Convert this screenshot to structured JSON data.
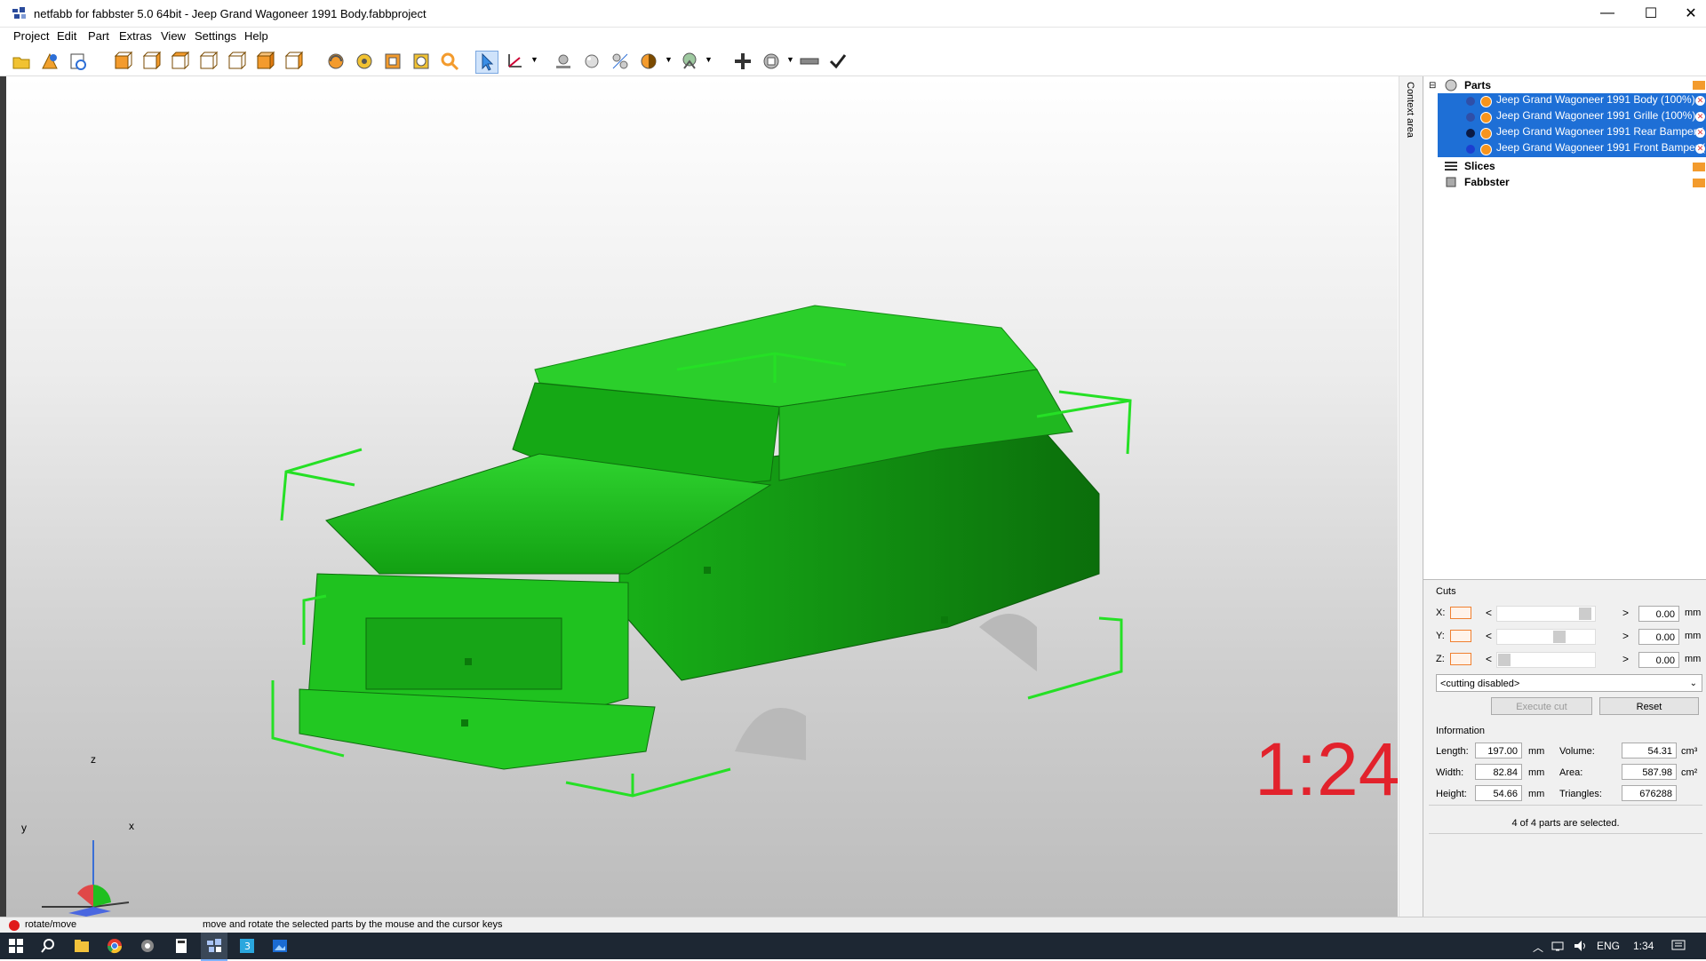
{
  "window": {
    "title": "netfabb for fabbster 5.0 64bit - Jeep Grand Wagoneer 1991 Body.fabbproject",
    "minimize": "—",
    "maximize": "☐",
    "close": "✕"
  },
  "menu": [
    "Project",
    "Edit",
    "Part",
    "Extras",
    "View",
    "Settings",
    "Help"
  ],
  "viewport": {
    "scale_text": "1:24",
    "axes": {
      "z": "z",
      "y": "y",
      "x": "x"
    },
    "model_color": "#1fc21f"
  },
  "context_tab": "Context area",
  "tree": {
    "parts_header": "Parts",
    "parts": [
      {
        "label": "Jeep Grand Wagoneer 1991 Body (100%)",
        "dot_color": "#2f4fa8"
      },
      {
        "label": "Jeep Grand Wagoneer 1991 Grille (100%)",
        "dot_color": "#2f4fa8"
      },
      {
        "label": "Jeep Grand Wagoneer 1991 Rear Bamper (",
        "dot_color": "#0b1a44"
      },
      {
        "label": "Jeep Grand Wagoneer 1991 Front Bamper (",
        "dot_color": "#1b3fd0"
      }
    ],
    "slices": "Slices",
    "fabbster": "Fabbster"
  },
  "cuts": {
    "title": "Cuts",
    "rows": [
      {
        "axis": "X:",
        "value": "0.00",
        "unit": "mm"
      },
      {
        "axis": "Y:",
        "value": "0.00",
        "unit": "mm"
      },
      {
        "axis": "Z:",
        "value": "0.00",
        "unit": "mm"
      }
    ],
    "mode": "<cutting disabled>",
    "execute": "Execute cut",
    "reset": "Reset"
  },
  "information": {
    "title": "Information",
    "length_label": "Length:",
    "length": "197.00",
    "length_unit": "mm",
    "width_label": "Width:",
    "width": "82.84",
    "width_unit": "mm",
    "height_label": "Height:",
    "height": "54.66",
    "height_unit": "mm",
    "volume_label": "Volume:",
    "volume": "54.31",
    "volume_unit": "cm³",
    "area_label": "Area:",
    "area": "587.98",
    "area_unit": "cm²",
    "triangles_label": "Triangles:",
    "triangles": "676288",
    "selection": "4 of 4 parts are selected."
  },
  "status": {
    "mode": "rotate/move",
    "hint": "move and rotate the selected parts by the mouse and the cursor keys"
  },
  "taskbar": {
    "lang": "ENG",
    "time": "1:34"
  }
}
